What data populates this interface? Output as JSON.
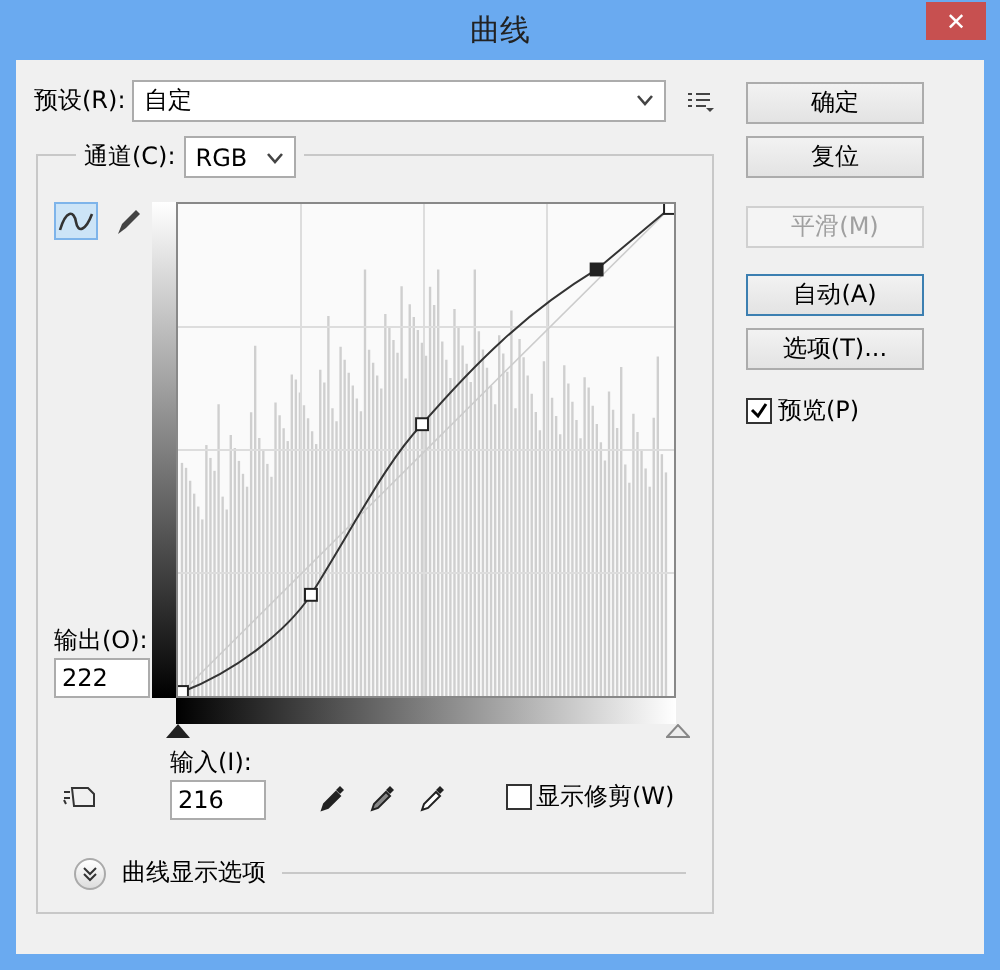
{
  "window": {
    "title": "曲线",
    "close": "✕"
  },
  "preset": {
    "label": "预设(R):",
    "value": "自定"
  },
  "channel": {
    "label": "通道(C):",
    "value": "RGB"
  },
  "tools": [
    {
      "kind": "curve",
      "selected": true
    },
    {
      "kind": "pencil",
      "selected": false
    }
  ],
  "output": {
    "label": "输出(O):",
    "value": "222"
  },
  "input": {
    "label": "输入(I):",
    "value": "216"
  },
  "show_clipping": {
    "label": "显示修剪(W)",
    "checked": false
  },
  "display_options": {
    "label": "曲线显示选项",
    "expanded": false
  },
  "buttons": [
    {
      "label": "确定",
      "disabled": false,
      "focused": false
    },
    {
      "label": "复位",
      "disabled": false,
      "focused": false
    },
    {
      "label": "平滑(M)",
      "disabled": true,
      "focused": false
    },
    {
      "label": "自动(A)",
      "disabled": false,
      "focused": true
    },
    {
      "label": "选项(T)...",
      "disabled": false,
      "focused": false
    }
  ],
  "preview": {
    "label": "预览(P)",
    "checked": true
  }
}
